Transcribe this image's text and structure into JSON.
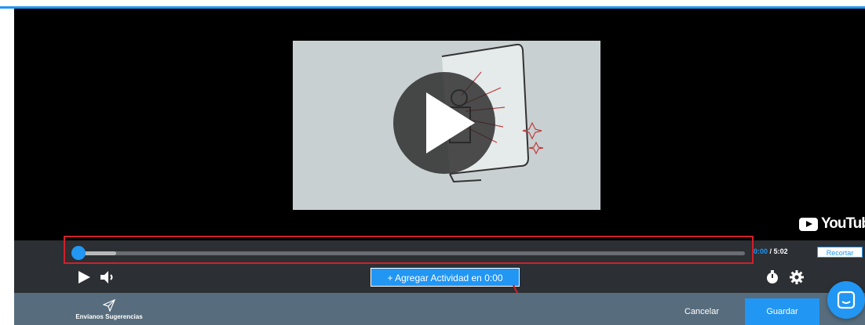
{
  "player": {
    "brand": "YouTube",
    "progress_fraction": 0.0,
    "buffered_fraction": 0.057
  },
  "controls": {
    "current_time": "0:00",
    "separator": "/",
    "duration": "5:02",
    "trim_label": "Recortar",
    "add_activity_label": "+ Agregar Actividad en 0:00"
  },
  "footer": {
    "suggestions_label": "Envíanos Sugerencias",
    "cancel_label": "Cancelar",
    "save_label": "Guardar"
  },
  "colors": {
    "accent": "#2196f3",
    "highlight": "#d0202a",
    "control_bar": "#2c2f33",
    "footer": "#576d7d"
  },
  "icons": [
    "play-icon",
    "volume-icon",
    "timer-icon",
    "gear-icon",
    "send-icon",
    "chat-icon",
    "youtube-logo-icon"
  ]
}
